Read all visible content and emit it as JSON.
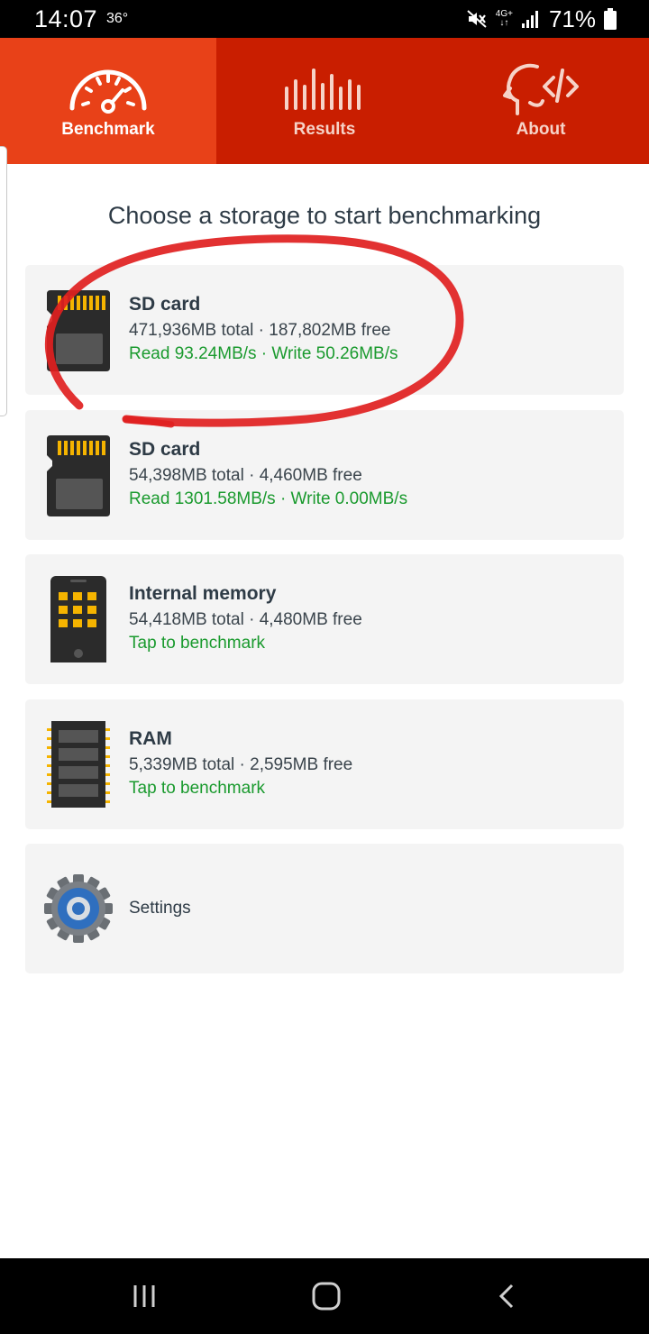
{
  "status_bar": {
    "time": "14:07",
    "temperature": "36°",
    "network_top": "4G+",
    "battery_percent": "71%",
    "icons": [
      "mute-icon",
      "signal-icon",
      "battery-icon"
    ]
  },
  "tabs": [
    {
      "label": "Benchmark",
      "icon": "speedometer-icon",
      "active": true
    },
    {
      "label": "Results",
      "icon": "bars-icon",
      "active": false
    },
    {
      "label": "About",
      "icon": "head-code-icon",
      "active": false
    }
  ],
  "heading": "Choose a storage to start benchmarking",
  "storages": [
    {
      "title": "SD card",
      "info": "471,936MB total · 187,802MB free",
      "speed": "Read 93.24MB/s · Write 50.26MB/s",
      "icon": "sd-card-icon"
    },
    {
      "title": "SD card",
      "info": "54,398MB total · 4,460MB free",
      "speed": "Read 1301.58MB/s · Write 0.00MB/s",
      "icon": "sd-card-icon"
    },
    {
      "title": "Internal memory",
      "info": "54,418MB total · 4,480MB free",
      "speed": "Tap to benchmark",
      "icon": "phone-memory-icon"
    },
    {
      "title": "RAM",
      "info": "5,339MB total · 2,595MB free",
      "speed": "Tap to benchmark",
      "icon": "ram-chip-icon"
    }
  ],
  "settings": {
    "label": "Settings",
    "icon": "gear-icon"
  },
  "colors": {
    "tab_active": "#e84118",
    "tab_bar": "#c91e00",
    "speed_green": "#1a9a2e",
    "annotation_red": "#e02020"
  },
  "navbar": {
    "icons": [
      "recents-icon",
      "home-icon",
      "back-icon"
    ]
  }
}
